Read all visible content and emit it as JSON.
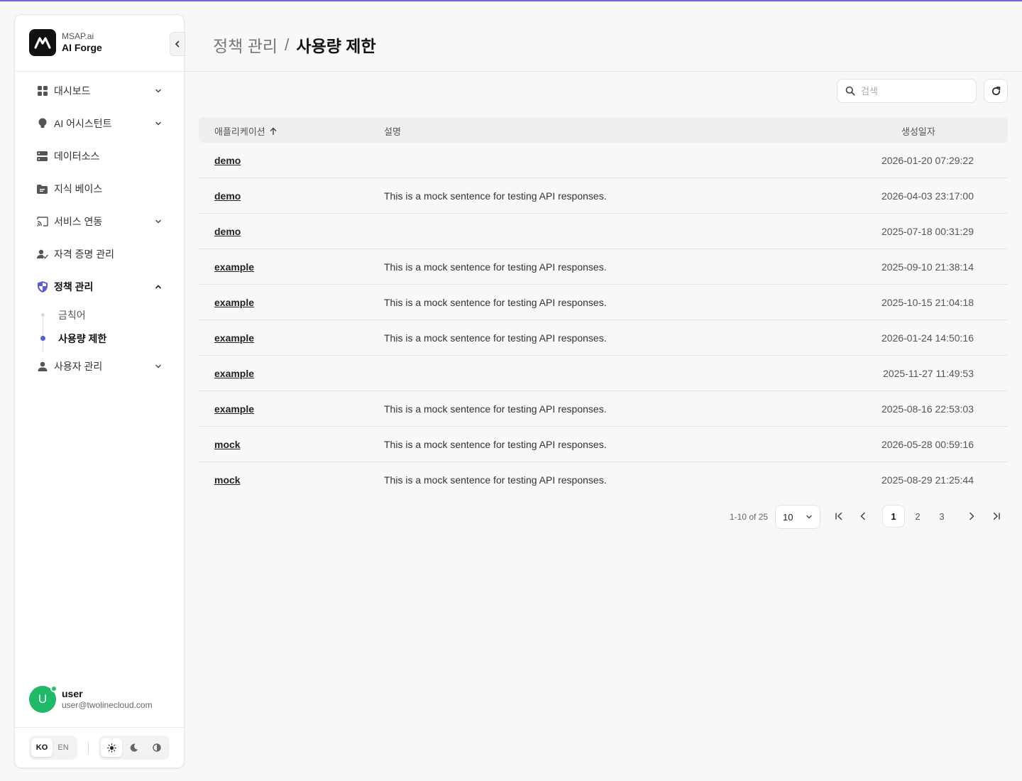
{
  "brand": {
    "sub": "MSAP.ai",
    "name": "AI Forge"
  },
  "nav": {
    "items": [
      {
        "label": "대시보드",
        "icon": "dashboard-icon",
        "expandable": true
      },
      {
        "label": "AI 어시스턴트",
        "icon": "lightbulb-icon",
        "expandable": true
      },
      {
        "label": "데이터소스",
        "icon": "server-icon",
        "expandable": false
      },
      {
        "label": "지식 베이스",
        "icon": "folder-icon",
        "expandable": false
      },
      {
        "label": "서비스 연동",
        "icon": "cast-icon",
        "expandable": true
      },
      {
        "label": "자격 증명 관리",
        "icon": "user-check-icon",
        "expandable": false
      },
      {
        "label": "정책 관리",
        "icon": "shield-icon",
        "expandable": true,
        "expanded": true
      },
      {
        "label": "사용자 관리",
        "icon": "person-icon",
        "expandable": true
      }
    ],
    "policy_sub": [
      {
        "label": "금칙어"
      },
      {
        "label": "사용량 제한",
        "active": true
      }
    ]
  },
  "user": {
    "initial": "U",
    "name": "user",
    "email": "user@twolinecloud.com"
  },
  "lang": {
    "ko": "KO",
    "en": "EN",
    "selected": "KO"
  },
  "theme": {
    "selected": "light"
  },
  "header": {
    "parent": "정책 관리",
    "separator": "/",
    "current": "사용량 제한"
  },
  "search": {
    "placeholder": "검색"
  },
  "table": {
    "columns": {
      "app": "애플리케이션",
      "desc": "설명",
      "date": "생성일자"
    },
    "sort": "app-ascending",
    "rows": [
      {
        "app": "demo",
        "desc": "",
        "date": "2026-01-20 07:29:22"
      },
      {
        "app": "demo",
        "desc": "This is a mock sentence for testing API responses.",
        "date": "2026-04-03 23:17:00"
      },
      {
        "app": "demo",
        "desc": "",
        "date": "2025-07-18 00:31:29"
      },
      {
        "app": "example",
        "desc": "This is a mock sentence for testing API responses.",
        "date": "2025-09-10 21:38:14"
      },
      {
        "app": "example",
        "desc": "This is a mock sentence for testing API responses.",
        "date": "2025-10-15 21:04:18"
      },
      {
        "app": "example",
        "desc": "This is a mock sentence for testing API responses.",
        "date": "2026-01-24 14:50:16"
      },
      {
        "app": "example",
        "desc": "",
        "date": "2025-11-27 11:49:53"
      },
      {
        "app": "example",
        "desc": "This is a mock sentence for testing API responses.",
        "date": "2025-08-16 22:53:03"
      },
      {
        "app": "mock",
        "desc": "This is a mock sentence for testing API responses.",
        "date": "2026-05-28 00:59:16"
      },
      {
        "app": "mock",
        "desc": "This is a mock sentence for testing API responses.",
        "date": "2025-08-29 21:25:44"
      }
    ]
  },
  "pagination": {
    "range": "1-10 of 25",
    "page_size": "10",
    "pages": [
      "1",
      "2",
      "3"
    ],
    "current": "1"
  },
  "colors": {
    "accent": "#6c63e6",
    "avatar": "#1fb968",
    "online": "#22c55e"
  }
}
